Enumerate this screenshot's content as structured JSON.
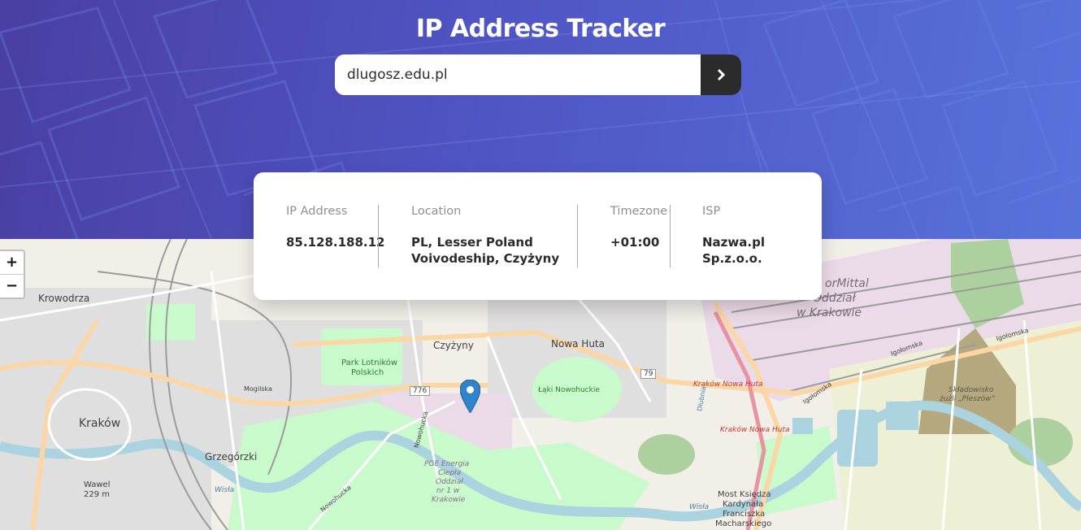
{
  "header": {
    "title": "IP Address Tracker"
  },
  "search": {
    "value": "dlugosz.edu.pl",
    "button_icon": "chevron-right-icon"
  },
  "info": {
    "ip": {
      "label": "IP Address",
      "value": "85.128.188.12"
    },
    "location": {
      "label": "Location",
      "value_line1": "PL, Lesser Poland",
      "value_line2": "Voivodeship, Czyżyny"
    },
    "timezone": {
      "label": "Timezone",
      "value": "+01:00"
    },
    "isp": {
      "label": "ISP",
      "value": "Nazwa.pl Sp.z.o.o."
    }
  },
  "map": {
    "zoom_in": "+",
    "zoom_out": "−",
    "marker_icon": "map-pin-icon",
    "labels": {
      "krowodrza": "Krowodrza",
      "krakow": "Kraków",
      "grzegorzki": "Grzegórzki",
      "wawel": "Wawel",
      "wawel_elev": "229 m",
      "park1": "Park Lotników",
      "park2": "Polskich",
      "czyzyny": "Czyżyny",
      "nowa_huta": "Nowa Huta",
      "laki": "Łąki Nowohuckie",
      "road776": "776",
      "road79": "79",
      "mogilska": "Mogilska",
      "nowohucka1": "Nowohucka",
      "nowohucka2": "Nowohucka",
      "pge1": "PGE Energia",
      "pge2": "Ciepła",
      "pge3": "Oddział",
      "pge4": "nr 1 w",
      "pge5": "Krakowie",
      "arcelor1": "orMittal",
      "arcelor2": "Oddział",
      "arcelor3": "w Krakowie",
      "kr_nowa_huta1": "Kraków Nowa Huta",
      "kr_nowa_huta2": "Kraków Nowa Huta",
      "dlubnia": "Dłubnia",
      "igolomska1": "Igołomska",
      "igolomska2": "Igołomska",
      "igolomska3": "Igołomska",
      "skladowisko1": "Składowisko",
      "skladowisko2": "żużli „Pleszów”",
      "wisla1": "Wisła",
      "wisla2": "Wisła",
      "most1": "Most Księdza",
      "most2": "Kardynała",
      "most3": "Franciszka",
      "most4": "Macharskiego"
    }
  },
  "colors": {
    "header_start": "#4a3fa2",
    "header_end": "#5872dc",
    "button": "#2b2b2b",
    "marker": "#2f84cb",
    "river": "#aad3df",
    "park": "#c8facc",
    "forest": "#add19e",
    "industrial": "#ebdbe8",
    "major_road": "#fcd6a4"
  }
}
